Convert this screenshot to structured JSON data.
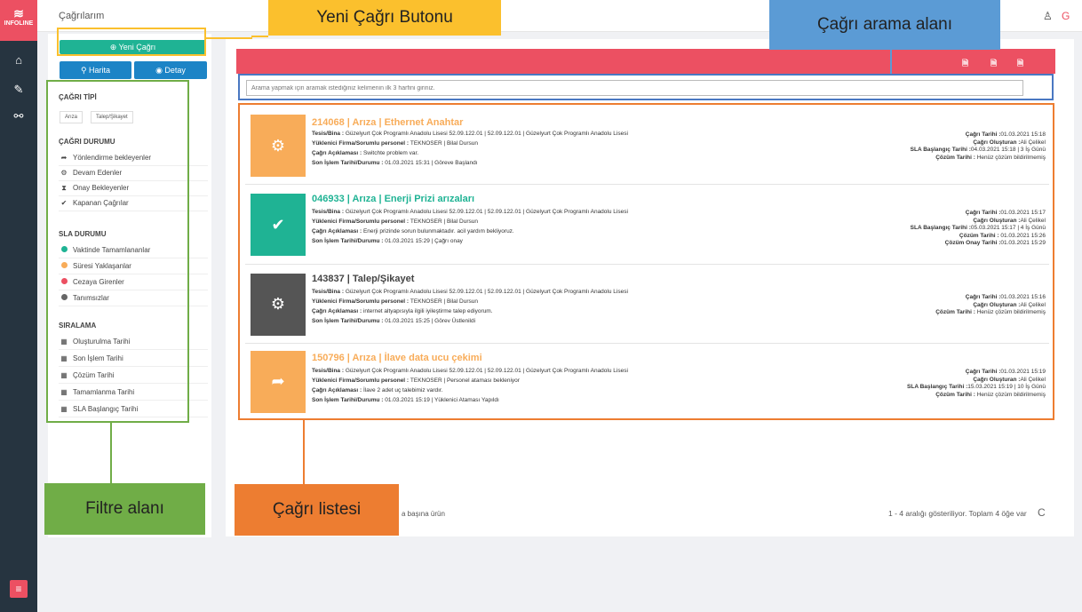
{
  "app": {
    "logo": "INFOLINE",
    "page_title": "Çağrılarım"
  },
  "sidebar": {
    "icons": [
      "home-icon",
      "wrench-icon",
      "sitemap-icon"
    ],
    "menu_glyph": "≡"
  },
  "topbar": {
    "user_glyph": "♙",
    "logout_glyph": "G"
  },
  "buttons": {
    "new_call": "⊕ Yeni Çağrı",
    "map": "⚲ Harita",
    "detail": "◉ Detay"
  },
  "filters": {
    "call_type_title": "ÇAĞRI TİPİ",
    "call_type_chips": [
      "Arıza",
      "Talep/Şikayet"
    ],
    "call_status_title": "ÇAĞRI DURUMU",
    "call_status_items": [
      {
        "label": "Yönlendirme bekleyenler",
        "icon": "share-icon",
        "glyph": "➦"
      },
      {
        "label": "Devam Edenler",
        "icon": "cogs-icon",
        "glyph": "⚙"
      },
      {
        "label": "Onay Bekleyenler",
        "icon": "hourglass-icon",
        "glyph": "⧗"
      },
      {
        "label": "Kapanan Çağrılar",
        "icon": "check-circle-icon",
        "glyph": "✔"
      }
    ],
    "sla_title": "SLA DURUMU",
    "sla_items": [
      {
        "label": "Vaktinde Tamamlananlar",
        "color": "#1fb394"
      },
      {
        "label": "Süresi Yaklaşanlar",
        "color": "#f8ac59"
      },
      {
        "label": "Cezaya Girenler",
        "color": "#ec5062"
      },
      {
        "label": "Tanımsızlar",
        "color": "#666666"
      }
    ],
    "sort_title": "SIRALAMA",
    "sort_items": [
      "Oluşturulma Tarihi",
      "Son İşlem Tarihi",
      "Çözüm Tarihi",
      "Tamamlanma Tarihi",
      "SLA Başlangıç Tarihi"
    ]
  },
  "search": {
    "placeholder": "Arama yapmak için aramak istediğiniz kelimenin ilk 3 harfini giriniz."
  },
  "calls": [
    {
      "title": "214068 | Arıza | Ethernet Anahtar",
      "color": "#f8ac59",
      "icon": "cogs-icon",
      "glyph": "⚙",
      "lines": [
        {
          "k": "Tesis/Bina : ",
          "v": "Güzelyurt Çok Programlı Anadolu Lisesi 52.09.122.01 | 52.09.122.01 | Güzelyurt Çok Programlı Anadolu Lisesi"
        },
        {
          "k": "Yüklenici Firma/Sorumlu personel : ",
          "v": "TEKNOSER | Bilal Dursun"
        },
        {
          "k": "Çağrı Açıklaması : ",
          "v": "Switchte problem var."
        },
        {
          "k": "Son İşlem Tarihi/Durumu : ",
          "v": "01.03.2021 15:31 | Göreve Başlandı"
        }
      ],
      "right": [
        {
          "k": "Çağrı Tarihi :",
          "v": "01.03.2021 15:18"
        },
        {
          "k": "Çağrı Oluşturan :",
          "v": "Ali Çelikel"
        },
        {
          "k": "SLA Başlangıç Tarihi :",
          "v": "04.03.2021 15:18 | 3 İş Günü"
        },
        {
          "k": "Çözüm Tarihi : ",
          "v": "Henüz çözüm bildirilmemiş"
        }
      ]
    },
    {
      "title": "046933 | Arıza | Enerji Prizi arızaları",
      "color": "#1fb394",
      "icon": "check-circle-icon",
      "glyph": "✔",
      "lines": [
        {
          "k": "Tesis/Bina : ",
          "v": "Güzelyurt Çok Programlı Anadolu Lisesi 52.09.122.01 | 52.09.122.01 | Güzelyurt Çok Programlı Anadolu Lisesi"
        },
        {
          "k": "Yüklenici Firma/Sorumlu personel : ",
          "v": "TEKNOSER | Bilal Dursun"
        },
        {
          "k": "Çağrı Açıklaması : ",
          "v": "Enerji prizinde sorun bulunmaktadır. acil yardım bekliyoruz."
        },
        {
          "k": "Son İşlem Tarihi/Durumu : ",
          "v": "01.03.2021 15:29 | Çağrı onay"
        }
      ],
      "right": [
        {
          "k": "Çağrı Tarihi :",
          "v": "01.03.2021 15:17"
        },
        {
          "k": "Çağrı Oluşturan :",
          "v": "Ali Çelikel"
        },
        {
          "k": "SLA Başlangıç Tarihi :",
          "v": "05.03.2021 15:17 | 4 İş Günü"
        },
        {
          "k": "Çözüm Tarihi : ",
          "v": "01.03.2021 15:26"
        },
        {
          "k": "Çözüm Onay Tarihi :",
          "v": "01.03.2021 15:29"
        }
      ]
    },
    {
      "title": "143837 | Talep/Şikayet",
      "color": "#555555",
      "icon": "cogs-icon",
      "glyph": "⚙",
      "lines": [
        {
          "k": "Tesis/Bina : ",
          "v": "Güzelyurt Çok Programlı Anadolu Lisesi 52.09.122.01 | 52.09.122.01 | Güzelyurt Çok Programlı Anadolu Lisesi"
        },
        {
          "k": "Yüklenici Firma/Sorumlu personel : ",
          "v": "TEKNOSER | Bilal Dursun"
        },
        {
          "k": "Çağrı Açıklaması : ",
          "v": "internet altyapısıyla ilgili iyileştirme talep ediyorum."
        },
        {
          "k": "Son İşlem Tarihi/Durumu : ",
          "v": "01.03.2021 15:25 | Görev Üstlenildi"
        }
      ],
      "right": [
        {
          "k": "Çağrı Tarihi :",
          "v": "01.03.2021 15:16"
        },
        {
          "k": "Çağrı Oluşturan :",
          "v": "Ali Çelikel"
        },
        {
          "k": "Çözüm Tarihi : ",
          "v": "Henüz çözüm bildirilmemiş"
        }
      ]
    },
    {
      "title": "150796 | Arıza | İlave data ucu çekimi",
      "color": "#f8ac59",
      "icon": "share-icon",
      "glyph": "➦",
      "lines": [
        {
          "k": "Tesis/Bina : ",
          "v": "Güzelyurt Çok Programlı Anadolu Lisesi 52.09.122.01 | 52.09.122.01 | Güzelyurt Çok Programlı Anadolu Lisesi"
        },
        {
          "k": "Yüklenici Firma/Sorumlu personel : ",
          "v": "TEKNOSER | Personel ataması bekleniyor"
        },
        {
          "k": "Çağrı Açıklaması : ",
          "v": "İlave 2 adet uç talebimiz vardır."
        },
        {
          "k": "Son İşlem Tarihi/Durumu : ",
          "v": "01.03.2021 15:19 | Yüklenici Ataması Yapıldı"
        }
      ],
      "right": [
        {
          "k": "Çağrı Tarihi :",
          "v": "01.03.2021 15:19"
        },
        {
          "k": "Çağrı Oluşturan :",
          "v": "Ali Çelikel"
        },
        {
          "k": "SLA Başlangıç Tarihi :",
          "v": "15.03.2021 15:19 | 10 İş Günü"
        },
        {
          "k": "Çözüm Tarihi : ",
          "v": "Henüz çözüm bildirilmemiş"
        }
      ]
    }
  ],
  "pagination": {
    "per_page_text": "a başına ürün",
    "summary": "1 - 4 aralığı gösteriliyor. Toplam 4 öğe var",
    "refresh_glyph": "C"
  },
  "annotations": {
    "new_call": "Yeni Çağrı Butonu",
    "search": "Çağrı arama alanı",
    "filter": "Filtre alanı",
    "list": "Çağrı listesi"
  },
  "colors": {
    "red": "#ec5062",
    "green": "#1fb394",
    "blue": "#1c84c6",
    "orange": "#f8ac59",
    "sidebar": "#263440"
  }
}
